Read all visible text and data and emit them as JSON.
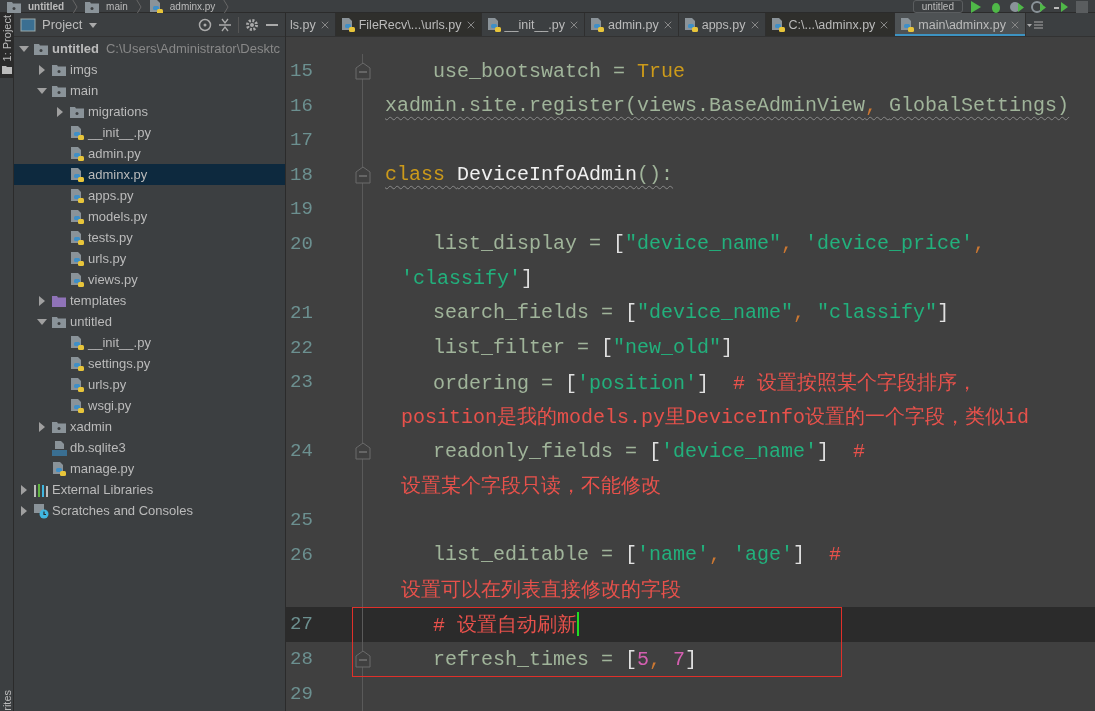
{
  "breadcrumb": [
    {
      "label": "untitled",
      "kind": "folder"
    },
    {
      "label": "main",
      "kind": "folder"
    },
    {
      "label": "adminx.py",
      "kind": "python"
    }
  ],
  "run_config": "untitled",
  "side_strip": {
    "top_label": "1: Project",
    "bottom_label": "rites"
  },
  "project_panel": {
    "title": "Project",
    "tree": [
      {
        "label": "untitled",
        "path": "C:\\Users\\Administrator\\Desktc",
        "kind": "folder",
        "expanded": true,
        "selected": false,
        "children": [
          {
            "label": "imgs",
            "kind": "folder",
            "expanded": false,
            "selected": false
          },
          {
            "label": "main",
            "kind": "folder",
            "expanded": true,
            "selected": false,
            "children": [
              {
                "label": "migrations",
                "kind": "folder",
                "expanded": false,
                "selected": false
              },
              {
                "label": "__init__.py",
                "kind": "python",
                "selected": false
              },
              {
                "label": "admin.py",
                "kind": "python",
                "selected": false
              },
              {
                "label": "adminx.py",
                "kind": "python",
                "selected": true
              },
              {
                "label": "apps.py",
                "kind": "python",
                "selected": false
              },
              {
                "label": "models.py",
                "kind": "python",
                "selected": false
              },
              {
                "label": "tests.py",
                "kind": "python",
                "selected": false
              },
              {
                "label": "urls.py",
                "kind": "python",
                "selected": false
              },
              {
                "label": "views.py",
                "kind": "python",
                "selected": false
              }
            ]
          },
          {
            "label": "templates",
            "kind": "templates",
            "expanded": false,
            "selected": false
          },
          {
            "label": "untitled",
            "kind": "folder",
            "expanded": true,
            "selected": false,
            "children": [
              {
                "label": "__init__.py",
                "kind": "python",
                "selected": false
              },
              {
                "label": "settings.py",
                "kind": "python",
                "selected": false
              },
              {
                "label": "urls.py",
                "kind": "python",
                "selected": false
              },
              {
                "label": "wsgi.py",
                "kind": "python",
                "selected": false
              }
            ]
          },
          {
            "label": "xadmin",
            "kind": "folder",
            "expanded": false,
            "selected": false
          },
          {
            "label": "db.sqlite3",
            "kind": "db",
            "selected": false
          },
          {
            "label": "manage.py",
            "kind": "python",
            "selected": false
          }
        ]
      },
      {
        "label": "External Libraries",
        "kind": "libraries",
        "expanded": false,
        "selected": false
      },
      {
        "label": "Scratches and Consoles",
        "kind": "scratches",
        "expanded": false,
        "selected": false
      }
    ]
  },
  "tabs": [
    {
      "label": "ls.py",
      "selected": false,
      "external": false
    },
    {
      "label": "FileRecv\\...\\urls.py",
      "selected": false,
      "external": true
    },
    {
      "label": "__init__.py",
      "selected": false,
      "external": false
    },
    {
      "label": "admin.py",
      "selected": false,
      "external": false
    },
    {
      "label": "apps.py",
      "selected": false,
      "external": false
    },
    {
      "label": "C:\\...\\adminx.py",
      "selected": false,
      "external": true
    },
    {
      "label": "main\\adminx.py",
      "selected": true,
      "external": false
    }
  ],
  "editor": {
    "lines": [
      {
        "kind": "line",
        "number": "15",
        "indented": true,
        "fold": true,
        "current": false,
        "boxed": false,
        "warning": false,
        "segments": [
          {
            "kind": "plain",
            "text": "use_bootswatch = "
          },
          {
            "kind": "keyword",
            "text": "True"
          }
        ]
      },
      {
        "kind": "line",
        "number": "16",
        "indented": false,
        "fold": false,
        "current": false,
        "boxed": false,
        "warning": true,
        "segments": [
          {
            "kind": "plain",
            "text": "xadmin.site.register(views.BaseAdminView"
          },
          {
            "kind": "sep",
            "text": ", "
          },
          {
            "kind": "plain",
            "text": "GlobalSettings)"
          }
        ]
      },
      {
        "kind": "line",
        "number": "17",
        "fold": false,
        "current": false,
        "boxed": false
      },
      {
        "kind": "line",
        "number": "18",
        "indented": false,
        "fold": true,
        "current": false,
        "boxed": false,
        "warning": true,
        "segments": [
          {
            "kind": "keyword",
            "text": "class "
          },
          {
            "kind": "defname",
            "text": "DeviceInfoAdmin"
          },
          {
            "kind": "plain",
            "text": "():"
          }
        ]
      },
      {
        "kind": "line",
        "number": "19",
        "fold": false,
        "current": false,
        "boxed": false
      },
      {
        "kind": "line",
        "number": "20",
        "indented": true,
        "fold": false,
        "current": false,
        "boxed": false,
        "warning": false,
        "segments": [
          {
            "kind": "plain",
            "text": "list_display = "
          },
          {
            "kind": "punct",
            "text": "["
          },
          {
            "kind": "string",
            "text": "\"device_name\""
          },
          {
            "kind": "sep",
            "text": ", "
          },
          {
            "kind": "string",
            "text": "'device_price'"
          },
          {
            "kind": "sep",
            "text": ","
          }
        ]
      },
      {
        "kind": "continuation",
        "fold": false,
        "current": false,
        "boxed": false,
        "warning": false,
        "segments": [
          {
            "kind": "string",
            "text": "'classify'"
          },
          {
            "kind": "punct",
            "text": "]"
          }
        ]
      },
      {
        "kind": "line",
        "number": "21",
        "indented": true,
        "fold": false,
        "current": false,
        "boxed": false,
        "warning": false,
        "segments": [
          {
            "kind": "plain",
            "text": "search_fields = "
          },
          {
            "kind": "punct",
            "text": "["
          },
          {
            "kind": "string",
            "text": "\"device_name\""
          },
          {
            "kind": "sep",
            "text": ", "
          },
          {
            "kind": "string",
            "text": "\"classify\""
          },
          {
            "kind": "punct",
            "text": "]"
          }
        ]
      },
      {
        "kind": "line",
        "number": "22",
        "indented": true,
        "fold": false,
        "current": false,
        "boxed": false,
        "warning": false,
        "segments": [
          {
            "kind": "plain",
            "text": "list_filter = "
          },
          {
            "kind": "punct",
            "text": "["
          },
          {
            "kind": "string",
            "text": "\"new_old\""
          },
          {
            "kind": "punct",
            "text": "]"
          }
        ]
      },
      {
        "kind": "line",
        "number": "23",
        "indented": true,
        "fold": false,
        "current": false,
        "boxed": false,
        "warning": false,
        "segments": [
          {
            "kind": "plain",
            "text": "ordering = "
          },
          {
            "kind": "punct",
            "text": "["
          },
          {
            "kind": "string",
            "text": "'position'"
          },
          {
            "kind": "punct",
            "text": "]"
          },
          {
            "kind": "comment",
            "text": "  # 设置按照某个字段排序，"
          }
        ]
      },
      {
        "kind": "continuation",
        "fold": false,
        "current": false,
        "boxed": false,
        "warning": false,
        "segments": [
          {
            "kind": "comment",
            "text": "position是我的models.py里DeviceInfo设置的一个字段，类似id"
          }
        ]
      },
      {
        "kind": "line",
        "number": "24",
        "indented": true,
        "fold": true,
        "current": false,
        "boxed": false,
        "warning": false,
        "segments": [
          {
            "kind": "plain",
            "text": "readonly_fields = "
          },
          {
            "kind": "punct",
            "text": "["
          },
          {
            "kind": "string",
            "text": "'device_name'"
          },
          {
            "kind": "punct",
            "text": "]"
          },
          {
            "kind": "comment",
            "text": "  #"
          }
        ]
      },
      {
        "kind": "continuation",
        "fold": false,
        "current": false,
        "boxed": false,
        "warning": false,
        "segments": [
          {
            "kind": "comment",
            "text": "设置某个字段只读，不能修改"
          }
        ]
      },
      {
        "kind": "line",
        "number": "25",
        "fold": false,
        "current": false,
        "boxed": false
      },
      {
        "kind": "line",
        "number": "26",
        "indented": true,
        "fold": false,
        "current": false,
        "boxed": false,
        "warning": false,
        "segments": [
          {
            "kind": "plain",
            "text": "list_editable = "
          },
          {
            "kind": "punct",
            "text": "["
          },
          {
            "kind": "string",
            "text": "'name'"
          },
          {
            "kind": "sep",
            "text": ", "
          },
          {
            "kind": "string",
            "text": "'age'"
          },
          {
            "kind": "punct",
            "text": "]"
          },
          {
            "kind": "comment",
            "text": "  #"
          }
        ]
      },
      {
        "kind": "continuation",
        "fold": false,
        "current": false,
        "boxed": false,
        "warning": false,
        "segments": [
          {
            "kind": "comment",
            "text": "设置可以在列表直接修改的字段"
          }
        ]
      },
      {
        "kind": "line",
        "number": "27",
        "indented": true,
        "fold": false,
        "current": true,
        "boxed": true,
        "warning": false,
        "segments": [
          {
            "kind": "comment",
            "text": "# 设置自动刷新"
          }
        ]
      },
      {
        "kind": "line",
        "number": "28",
        "indented": true,
        "fold": true,
        "current": false,
        "boxed": true,
        "warning": false,
        "segments": [
          {
            "kind": "plain",
            "text": "refresh_times = "
          },
          {
            "kind": "punct",
            "text": "["
          },
          {
            "kind": "number",
            "text": "5"
          },
          {
            "kind": "sep",
            "text": ", "
          },
          {
            "kind": "number",
            "text": "7"
          },
          {
            "kind": "punct",
            "text": "]"
          }
        ]
      },
      {
        "kind": "line",
        "number": "29",
        "fold": false,
        "current": false,
        "boxed": false
      }
    ]
  }
}
